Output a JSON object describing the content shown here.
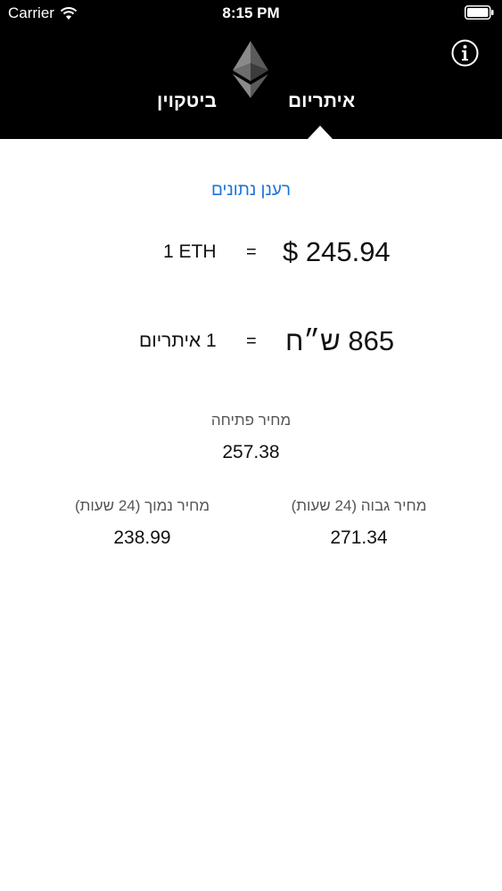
{
  "status_bar": {
    "carrier": "Carrier",
    "time": "8:15 PM"
  },
  "header": {
    "logo_icon": "ethereum-logo-icon",
    "info_icon": "info-icon",
    "tabs": [
      {
        "label": "איתריום",
        "selected": true
      },
      {
        "label": "ביטקוין",
        "selected": false
      }
    ]
  },
  "refresh_label": "רענן נתונים",
  "rates": {
    "usd": {
      "unit": "1 ETH",
      "equals": "=",
      "price": "$ 245.94"
    },
    "ils": {
      "unit": "1 איתריום",
      "equals": "=",
      "price": "865 ש״ח"
    }
  },
  "stats": {
    "open": {
      "label": "מחיר פתיחה",
      "value": "257.38"
    },
    "high": {
      "label": "מחיר גבוה (24 שעות)",
      "value": "271.34"
    },
    "low": {
      "label": "מחיר נמוך (24 שעות)",
      "value": "238.99"
    }
  },
  "colors": {
    "header_bg": "#000000",
    "link": "#1a73d9"
  }
}
